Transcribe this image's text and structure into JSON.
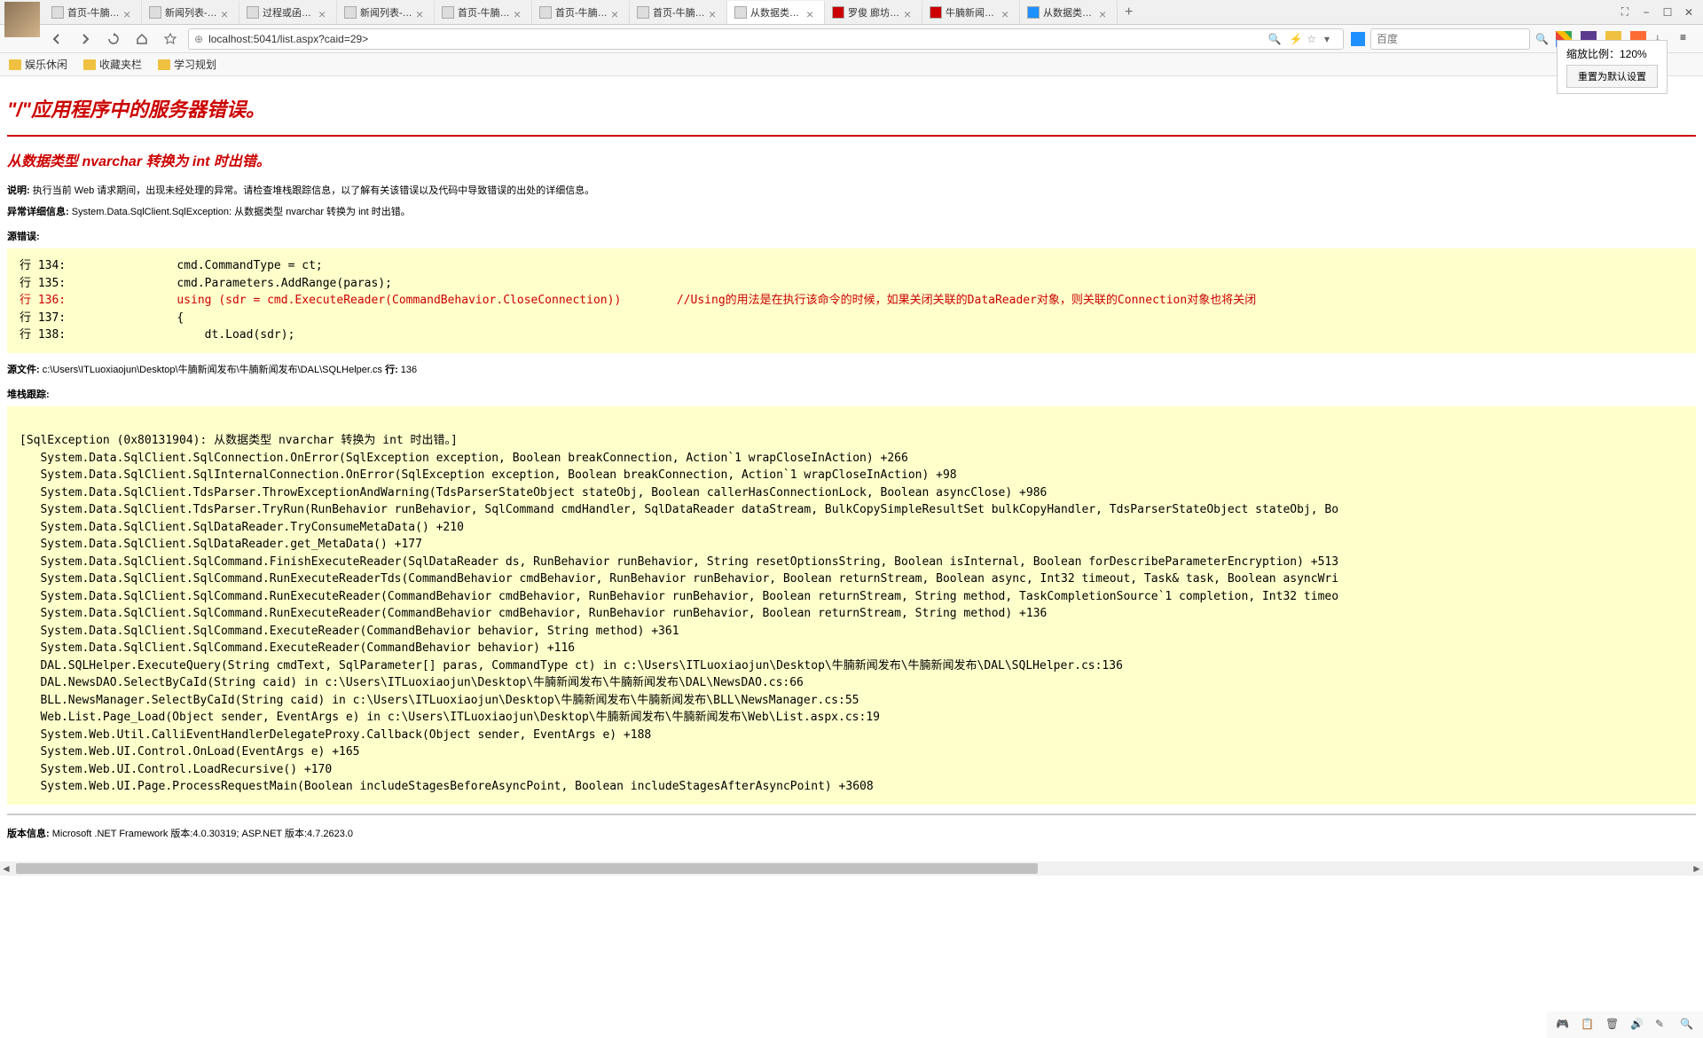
{
  "tabs": [
    {
      "label": "首页-牛腩新闻发... ",
      "icon": "page"
    },
    {
      "label": "新闻列表-牛腩新...",
      "icon": "page"
    },
    {
      "label": "过程或函数 'new...",
      "icon": "page"
    },
    {
      "label": "新闻列表-牛腩新...",
      "icon": "page"
    },
    {
      "label": "首页-牛腩新闻发...",
      "icon": "page"
    },
    {
      "label": "首页-牛腩新闻发...",
      "icon": "page"
    },
    {
      "label": "首页-牛腩新闻发...",
      "icon": "page"
    },
    {
      "label": "从数据类型 nvarc...",
      "icon": "page",
      "active": true
    },
    {
      "label": "罗俊 廊坊师范学...",
      "icon": "red"
    },
    {
      "label": "牛腩新闻发布--记...",
      "icon": "red"
    },
    {
      "label": "从数据类型 nvarc...",
      "icon": "blue"
    }
  ],
  "url": "localhost:5041/list.aspx?caid=29>",
  "search_placeholder": "百度",
  "bookmarks": [
    {
      "label": "娱乐休闲"
    },
    {
      "label": "收藏夹栏"
    },
    {
      "label": "学习规划"
    }
  ],
  "zoom": {
    "label": "缩放比例：120%",
    "reset": "重置为默认设置"
  },
  "error": {
    "title": "\"/\"应用程序中的服务器错误。",
    "subtitle": "从数据类型 nvarchar 转换为 int 时出错。",
    "desc_label": "说明:",
    "desc_text": " 执行当前 Web 请求期间，出现未经处理的异常。请检查堆栈跟踪信息，以了解有关该错误以及代码中导致错误的出处的详细信息。",
    "exception_label": "异常详细信息:",
    "exception_text": " System.Data.SqlClient.SqlException: 从数据类型 nvarchar 转换为 int 时出错。",
    "source_error_label": "源错误:"
  },
  "code": {
    "line134": "行 134:                cmd.CommandType = ct;",
    "line135": "行 135:                cmd.Parameters.AddRange(paras);",
    "line136": "行 136:                using (sdr = cmd.ExecuteReader(CommandBehavior.CloseConnection))        //Using的用法是在执行该命令的时候，如果关闭关联的DataReader对象，则关联的Connection对象也将关闭",
    "line137": "行 137:                {",
    "line138": "行 138:                    dt.Load(sdr);"
  },
  "source_file": {
    "label": "源文件:",
    "path": " c:\\Users\\ITLuoxiaojun\\Desktop\\牛腩新闻发布\\牛腩新闻发布\\DAL\\SQLHelper.cs",
    "line_label": "    行:",
    "line_num": " 136"
  },
  "stack": {
    "label": "堆栈跟踪:",
    "text": "\n[SqlException (0x80131904): 从数据类型 nvarchar 转换为 int 时出错。]\n   System.Data.SqlClient.SqlConnection.OnError(SqlException exception, Boolean breakConnection, Action`1 wrapCloseInAction) +266\n   System.Data.SqlClient.SqlInternalConnection.OnError(SqlException exception, Boolean breakConnection, Action`1 wrapCloseInAction) +98\n   System.Data.SqlClient.TdsParser.ThrowExceptionAndWarning(TdsParserStateObject stateObj, Boolean callerHasConnectionLock, Boolean asyncClose) +986\n   System.Data.SqlClient.TdsParser.TryRun(RunBehavior runBehavior, SqlCommand cmdHandler, SqlDataReader dataStream, BulkCopySimpleResultSet bulkCopyHandler, TdsParserStateObject stateObj, Bo\n   System.Data.SqlClient.SqlDataReader.TryConsumeMetaData() +210\n   System.Data.SqlClient.SqlDataReader.get_MetaData() +177\n   System.Data.SqlClient.SqlCommand.FinishExecuteReader(SqlDataReader ds, RunBehavior runBehavior, String resetOptionsString, Boolean isInternal, Boolean forDescribeParameterEncryption) +513\n   System.Data.SqlClient.SqlCommand.RunExecuteReaderTds(CommandBehavior cmdBehavior, RunBehavior runBehavior, Boolean returnStream, Boolean async, Int32 timeout, Task& task, Boolean asyncWri\n   System.Data.SqlClient.SqlCommand.RunExecuteReader(CommandBehavior cmdBehavior, RunBehavior runBehavior, Boolean returnStream, String method, TaskCompletionSource`1 completion, Int32 timeo\n   System.Data.SqlClient.SqlCommand.RunExecuteReader(CommandBehavior cmdBehavior, RunBehavior runBehavior, Boolean returnStream, String method) +136\n   System.Data.SqlClient.SqlCommand.ExecuteReader(CommandBehavior behavior, String method) +361\n   System.Data.SqlClient.SqlCommand.ExecuteReader(CommandBehavior behavior) +116\n   DAL.SQLHelper.ExecuteQuery(String cmdText, SqlParameter[] paras, CommandType ct) in c:\\Users\\ITLuoxiaojun\\Desktop\\牛腩新闻发布\\牛腩新闻发布\\DAL\\SQLHelper.cs:136\n   DAL.NewsDAO.SelectByCaId(String caid) in c:\\Users\\ITLuoxiaojun\\Desktop\\牛腩新闻发布\\牛腩新闻发布\\DAL\\NewsDAO.cs:66\n   BLL.NewsManager.SelectByCaId(String caid) in c:\\Users\\ITLuoxiaojun\\Desktop\\牛腩新闻发布\\牛腩新闻发布\\BLL\\NewsManager.cs:55\n   Web.List.Page_Load(Object sender, EventArgs e) in c:\\Users\\ITLuoxiaojun\\Desktop\\牛腩新闻发布\\牛腩新闻发布\\Web\\List.aspx.cs:19\n   System.Web.Util.CalliEventHandlerDelegateProxy.Callback(Object sender, EventArgs e) +188\n   System.Web.UI.Control.OnLoad(EventArgs e) +165\n   System.Web.UI.Control.LoadRecursive() +170\n   System.Web.UI.Page.ProcessRequestMain(Boolean includeStagesBeforeAsyncPoint, Boolean includeStagesAfterAsyncPoint) +3608\n"
  },
  "version": {
    "label": "版本信息:",
    "text": " Microsoft .NET Framework 版本:4.0.30319; ASP.NET 版本:4.7.2623.0"
  }
}
